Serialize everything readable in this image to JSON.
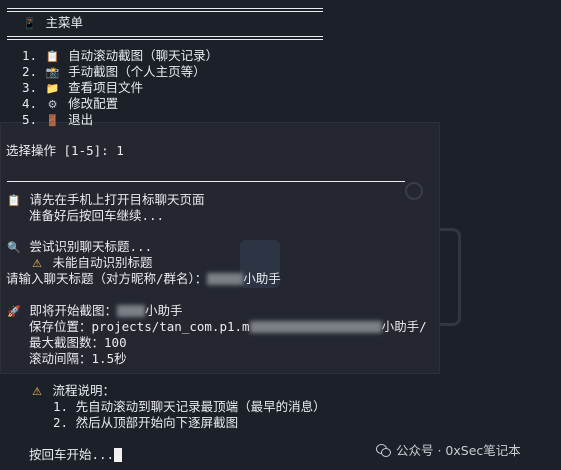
{
  "menu": {
    "title_icon": "phone-icon",
    "title": "主菜单",
    "items": [
      {
        "num": "1.",
        "icon": "clipboard-icon",
        "label": "自动滚动截图（聊天记录）"
      },
      {
        "num": "2.",
        "icon": "camera-icon",
        "label": "手动截图（个人主页等）"
      },
      {
        "num": "3.",
        "icon": "folder-icon",
        "label": "查看项目文件"
      },
      {
        "num": "4.",
        "icon": "gear-icon",
        "label": "修改配置"
      },
      {
        "num": "5.",
        "icon": "door-icon",
        "label": "退出"
      }
    ]
  },
  "prompt": {
    "label": "选择操作 [1-5]: ",
    "value": "1"
  },
  "session": {
    "open_chat": "请先在手机上打开目标聊天页面",
    "press_enter_continue": "准备好后按回车继续...",
    "detecting": "尝试识别聊天标题...",
    "not_detected": "未能自动识别标题",
    "enter_title_label": "请输入聊天标题（对方昵称/群名）：",
    "entered_title_suffix": "小助手",
    "about_to_start_label": "即将开始截图：",
    "start_title_suffix": "小助手",
    "save_label": "保存位置：",
    "save_path_prefix": "projects/tan_com.p1.m",
    "save_path_suffix": "小助手/",
    "max_shots_label": "最大截图数：",
    "max_shots_value": "100",
    "interval_label": "滚动间隔：",
    "interval_value": "1.5秒",
    "flow_title": "流程说明：",
    "flow_steps": [
      "1. 先自动滚动到聊天记录最顶端（最早的消息）",
      "2. 然后从顶部开始向下逐屏截图"
    ],
    "press_enter_start": "按回车开始..."
  },
  "watermark": "公众号 · 0xSec笔记本",
  "colors": {
    "background": "#1c2029",
    "text": "#e9ebee",
    "warning": "#f5c542"
  }
}
